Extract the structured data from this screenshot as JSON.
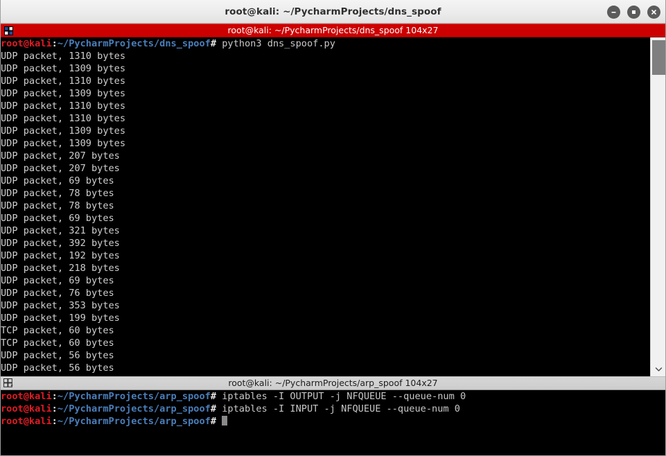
{
  "window": {
    "title": "root@kali: ~/PycharmProjects/dns_spoof",
    "minimize_label": "–",
    "maximize_label": "■",
    "close_label": "×",
    "colors": {
      "active_tab_bg": "#cc0000",
      "inactive_tab_bg": "#d2d2d2",
      "titlebar_bg": "#eeeeee",
      "terminal_bg": "#000000",
      "prompt_user": "#e01b24",
      "prompt_path": "#4a7ebb",
      "output_text": "#cfcfcf",
      "scrollbar_thumb": "#7f7f7f"
    }
  },
  "panes": [
    {
      "tab_label": "root@kali: ~/PycharmProjects/dns_spoof 104x27",
      "tab_icon": "grid-icon",
      "active": true,
      "prompt": {
        "user_host": "root@kali",
        "separator": ":",
        "path": "~/PycharmProjects/dns_spoof",
        "sigil": "#"
      },
      "lines": [
        {
          "type": "prompt",
          "command": "python3 dns_spoof.py"
        },
        {
          "type": "output",
          "text": "UDP packet, 1310 bytes"
        },
        {
          "type": "output",
          "text": "UDP packet, 1309 bytes"
        },
        {
          "type": "output",
          "text": "UDP packet, 1310 bytes"
        },
        {
          "type": "output",
          "text": "UDP packet, 1309 bytes"
        },
        {
          "type": "output",
          "text": "UDP packet, 1310 bytes"
        },
        {
          "type": "output",
          "text": "UDP packet, 1310 bytes"
        },
        {
          "type": "output",
          "text": "UDP packet, 1309 bytes"
        },
        {
          "type": "output",
          "text": "UDP packet, 1309 bytes"
        },
        {
          "type": "output",
          "text": "UDP packet, 207 bytes"
        },
        {
          "type": "output",
          "text": "UDP packet, 207 bytes"
        },
        {
          "type": "output",
          "text": "UDP packet, 69 bytes"
        },
        {
          "type": "output",
          "text": "UDP packet, 78 bytes"
        },
        {
          "type": "output",
          "text": "UDP packet, 78 bytes"
        },
        {
          "type": "output",
          "text": "UDP packet, 69 bytes"
        },
        {
          "type": "output",
          "text": "UDP packet, 321 bytes"
        },
        {
          "type": "output",
          "text": "UDP packet, 392 bytes"
        },
        {
          "type": "output",
          "text": "UDP packet, 192 bytes"
        },
        {
          "type": "output",
          "text": "UDP packet, 218 bytes"
        },
        {
          "type": "output",
          "text": "UDP packet, 69 bytes"
        },
        {
          "type": "output",
          "text": "UDP packet, 76 bytes"
        },
        {
          "type": "output",
          "text": "UDP packet, 353 bytes"
        },
        {
          "type": "output",
          "text": "UDP packet, 199 bytes"
        },
        {
          "type": "output",
          "text": "TCP packet, 60 bytes"
        },
        {
          "type": "output",
          "text": "TCP packet, 60 bytes"
        },
        {
          "type": "output",
          "text": "UDP packet, 56 bytes"
        },
        {
          "type": "output",
          "text": "UDP packet, 56 bytes"
        }
      ]
    },
    {
      "tab_label": "root@kali: ~/PycharmProjects/arp_spoof 104x27",
      "tab_icon": "grid-icon",
      "active": false,
      "prompt": {
        "user_host": "root@kali",
        "separator": ":",
        "path": "~/PycharmProjects/arp_spoof",
        "sigil": "#"
      },
      "lines": [
        {
          "type": "prompt",
          "command": "iptables -I OUTPUT -j NFQUEUE --queue-num 0"
        },
        {
          "type": "prompt",
          "command": "iptables -I INPUT -j NFQUEUE --queue-num 0"
        },
        {
          "type": "prompt",
          "command": "",
          "cursor": true
        }
      ]
    }
  ],
  "scrollbar": {
    "thumb_position_percent": 2,
    "thumb_size_percent": 10,
    "down_arrow_icon": "chevron-down-icon"
  }
}
